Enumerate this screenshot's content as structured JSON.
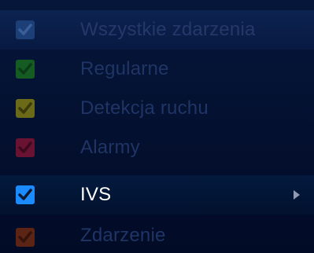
{
  "event_filter": {
    "items": [
      {
        "label": "Wszystkie zdarzenia",
        "checked": true,
        "color": "#2a4f8a",
        "state": "dimmed"
      },
      {
        "label": "Regularne",
        "checked": true,
        "color": "#1b5e2a",
        "state": "dimmed"
      },
      {
        "label": "Detekcja ruchu",
        "checked": true,
        "color": "#6b6a1c",
        "state": "dimmed"
      },
      {
        "label": "Alarmy",
        "checked": true,
        "color": "#6b1330",
        "state": "dimmed"
      },
      {
        "label": "IVS",
        "checked": true,
        "color": "#1e90ff",
        "state": "selected",
        "has_submenu": true,
        "submenu_icon": "chevron-right-icon"
      },
      {
        "label": "Zdarzenie",
        "checked": true,
        "color": "#6b2a1a",
        "state": "dimmed"
      }
    ]
  }
}
